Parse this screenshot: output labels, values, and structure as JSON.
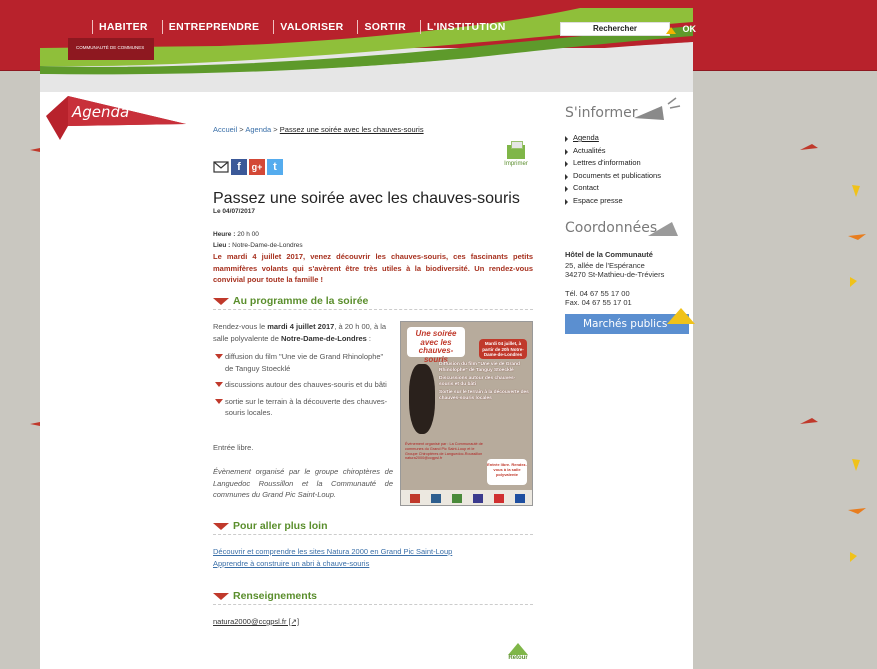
{
  "colors": {
    "brand_red": "#b8222c",
    "green": "#5a8e2c",
    "intro_red": "#a7311f",
    "link_blue": "#3a6fa8",
    "public_blue": "#5b8fd0"
  },
  "nav": {
    "items": [
      "HABITER",
      "ENTREPRENDRE",
      "VALORISER",
      "SORTIR",
      "L'INSTITUTION"
    ],
    "logo_text": "COMMUNAUTÉ DE COMMUNES"
  },
  "search": {
    "label": "Rechercher",
    "ok": "OK"
  },
  "agenda_tab": "Agenda",
  "breadcrumb": {
    "home": "Accueil",
    "sep": ">",
    "section": "Agenda",
    "current": "Passez une soirée avec les chauves-souris"
  },
  "share": {
    "icons": [
      "mail-icon",
      "facebook-icon",
      "google-plus-icon",
      "twitter-icon"
    ]
  },
  "print_label": "Imprimer",
  "article": {
    "title": "Passez une soirée avec les chauves-souris",
    "date_prefix": "Le",
    "date": "04/07/2017",
    "heure_label": "Heure :",
    "heure": "20 h 00",
    "lieu_label": "Lieu :",
    "lieu": "Notre-Dame-de-Londres",
    "intro": "Le mardi 4 juillet 2017, venez découvrir les chauves-souris, ces fascinants petits mammifères volants qui s'avèrent être très utiles à la biodiversité. Un rendez-vous convivial pour toute la famille !",
    "section_programme": "Au programme de la soirée",
    "rdv_1": "Rendez-vous le",
    "rdv_bold_1": "mardi 4 juillet 2017",
    "rdv_2": ", à 20 h 00, à la salle polyvalente de",
    "rdv_bold_2": "Notre-Dame-de-Londres",
    "rdv_3": ":",
    "bullets": [
      "diffusion du film \"Une vie de Grand Rhinolophe\" de Tanguy Stoecklé",
      "discussions autour des chauves-souris et du bâti",
      "sortie sur le terrain à la découverte des chauves-souris locales."
    ],
    "entree": "Entrée libre.",
    "organise": "Évènement organisé par le groupe chiroptères de Languedoc Roussillon et la Communauté de communes du Grand Pic Saint-Loup.",
    "section_loin": "Pour aller plus loin",
    "links": [
      "Découvrir et comprendre les sites Natura 2000 en Grand Pic Saint-Loup",
      "Apprendre à construire un abri à chauve-souris"
    ],
    "section_renseignements": "Renseignements",
    "email": "natura2000@ccgpsl.fr [↗]"
  },
  "poster": {
    "title": "Une soirée avec les chauves-souris",
    "date": "Mardi 04 juillet, à partir de 20h Notre-Dame-de-Londres",
    "items": [
      "Diffusion du film \"Une vie de Grand Rhinolophe\" de Tanguy Stoecklé",
      "Discussions autour des chauves-souris et du bâti",
      "Sortie sur le terrain à la découverte des chauves-souris locales"
    ],
    "organisation": "Évènement organisé par : La Communauté de communes du Grand Pic Saint-Loup et le Groupe Chiroptères de Languedoc-Roussillon",
    "contact": "natura2000@ccgpsl.fr",
    "free": "Entrée libre. Rendez-vous à la salle polyvalente"
  },
  "retour": "Retour",
  "sidebar": {
    "informer_title": "S'informer",
    "items": [
      "Agenda",
      "Actualités",
      "Lettres d'information",
      "Documents et publications",
      "Contact",
      "Espace presse"
    ],
    "coord_title": "Coordonnées",
    "coord_name": "Hôtel de la Communauté",
    "coord_lines": [
      "25, allée de l'Espérance",
      "34270 St-Mathieu-de-Tréviers"
    ],
    "tel": "Tél. 04 67 55 17 00",
    "fax": "Fax. 04 67 55 17 01",
    "marches": "Marchés publics"
  }
}
